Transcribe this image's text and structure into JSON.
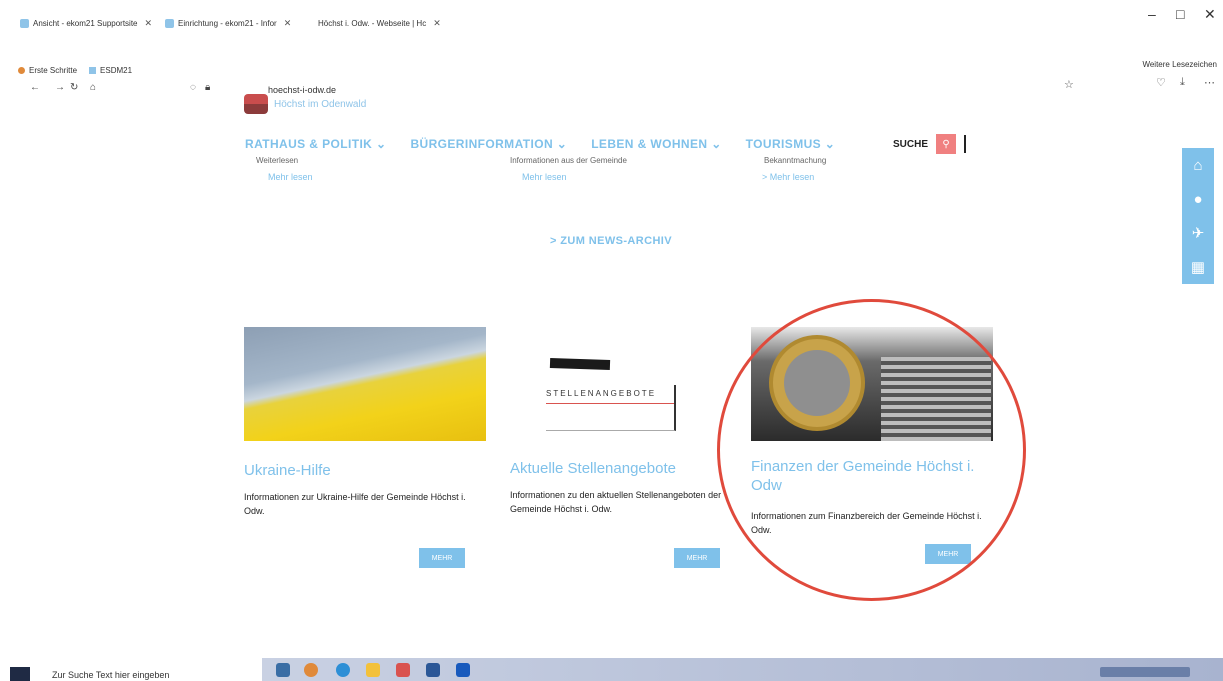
{
  "browser": {
    "tabs": [
      "Ansicht - ekom21 Supportsite",
      "Einrichtung - ekom21 - Infor",
      "Höchst i. Odw. - Webseite | Hc"
    ],
    "url": "hoechst-i-odw.de",
    "bookmarks": [
      "Erste Schritte",
      "ESDM21"
    ],
    "other_bookmarks": "Weitere Lesezeichen"
  },
  "site": {
    "logo_text": "Höchst im Odenwald",
    "nav": [
      "RATHAUS & POLITIK ⌄",
      "BÜRGERINFORMATION ⌄",
      "LEBEN & WOHNEN ⌄",
      "TOURISMUS ⌄"
    ],
    "search_label": "SUCHE",
    "news_cut": [
      "Weiterlesen",
      "Informationen aus der Gemeinde",
      "Bekanntmachung"
    ],
    "mehr_lesen": "Mehr lesen",
    "mehr_lesen_arrow": "> Mehr lesen",
    "archive_link": "> ZUM NEWS-ARCHIV"
  },
  "cards": [
    {
      "title": "Ukraine-Hilfe",
      "desc": "Informationen zur Ukraine-Hilfe der Gemeinde Höchst i. Odw.",
      "button": "MEHR"
    },
    {
      "title": "Aktuelle Stellenangebote",
      "desc": "Informationen zu den aktuellen Stellenangeboten der Gemeinde Höchst i. Odw.",
      "button": "MEHR",
      "image_text": "STELLENANGEBOTE"
    },
    {
      "title": "Finanzen der Gemeinde Höchst i. Odw",
      "desc": "Informationen zum Finanzbereich der Gemeinde Höchst i. Odw.",
      "button": "MEHR"
    }
  ],
  "taskbar": {
    "search_placeholder": "Zur Suche Text hier eingeben"
  },
  "colors": {
    "accent": "#7fc1ea",
    "search_button": "#f08080",
    "annotation_circle": "#e04a3c"
  }
}
